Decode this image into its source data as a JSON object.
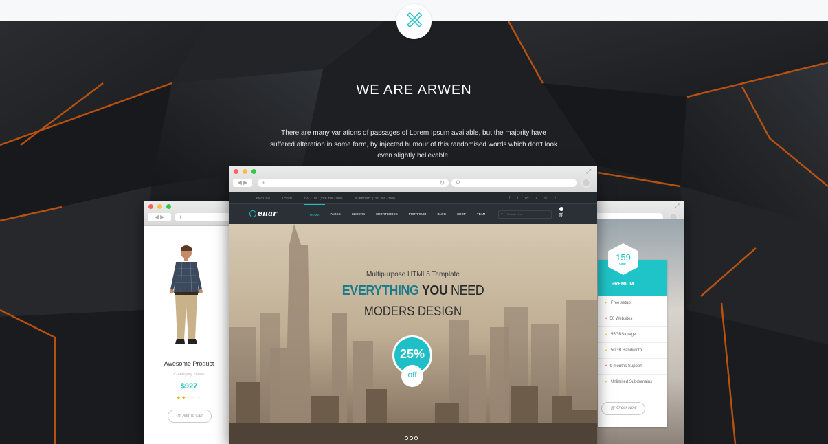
{
  "header": {
    "icon": "pencil-ruler-icon"
  },
  "intro": {
    "title": "WE ARE ARWEN",
    "description": "There are many variations of passages of Lorem Ipsum available, but the majority have suffered alteration in some form, by injected humour of this randomised words which don't look even slightly believable."
  },
  "colors": {
    "accent": "#19c2c2",
    "dark_bg": "#1f2124",
    "orange_edge": "#c8570f"
  },
  "main_browser": {
    "info_bar": [
      "ENGLISH",
      "LOGIN",
      "CALL US : (123) 456 - 7890",
      "SUPPORT : (123) 456 - 7890"
    ],
    "social_icons": [
      "facebook-icon",
      "twitter-icon",
      "google-plus-icon",
      "skype-icon",
      "dribbble-icon",
      "vimeo-icon"
    ],
    "brand": "enar",
    "menu": [
      "HOME",
      "PAGES",
      "SLIDERS",
      "SHORTCODES",
      "PORTFOLIO",
      "BLOG",
      "SHOP",
      "TEAM"
    ],
    "active_menu": "HOME",
    "search_placeholder": "Search Here",
    "cart_count": "0",
    "hero": {
      "subtitle": "Multipurpose HTML5 Template",
      "headline_1": "EVERYTHING",
      "headline_2": "YOU",
      "headline_3": "NEED",
      "headline_line2": "MODERS DESIGN",
      "discount": "25%",
      "discount_label": "off"
    }
  },
  "left_browser": {
    "product": {
      "name": "Awesome Product",
      "category": "Caategory Name",
      "price": "$927",
      "rating": 2,
      "rating_max": 5,
      "button": "Add To Cart"
    }
  },
  "right_browser": {
    "plan": {
      "price": "159",
      "period": "$/MO",
      "name": "PREMIUM",
      "features": [
        {
          "label": "Free setup",
          "included": true
        },
        {
          "label": "50 Websites",
          "included": false
        },
        {
          "label": "55GBStorage",
          "included": true
        },
        {
          "label": "50GB Bandwidth",
          "included": true
        },
        {
          "label": "9 months Support",
          "included": false
        },
        {
          "label": "Unlimited Subdomains",
          "included": true
        }
      ],
      "button": "Order Now"
    }
  }
}
